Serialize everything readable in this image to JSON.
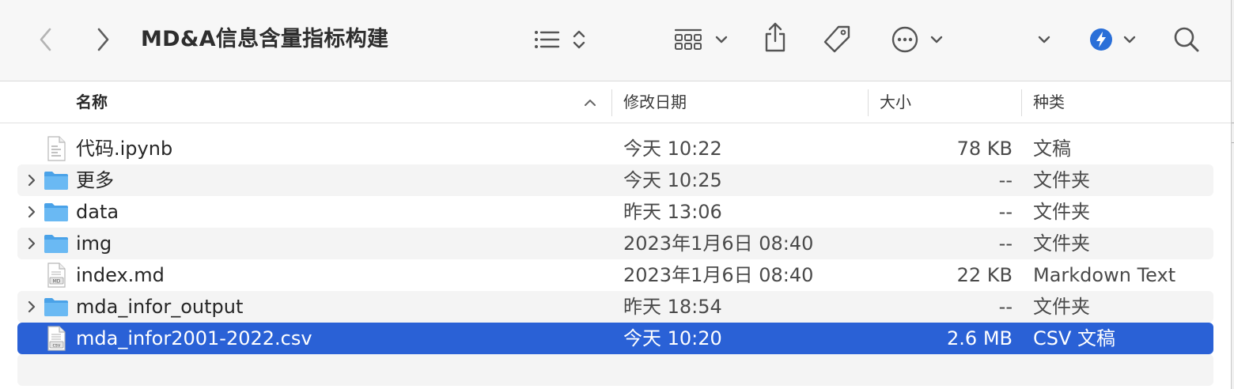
{
  "window": {
    "title": "MD&A信息含量指标构建"
  },
  "toolbar": {
    "back_icon": "chevron-left-icon",
    "forward_icon": "chevron-right-icon",
    "view_icon": "list-view-icon",
    "group_icon": "grid-group-icon",
    "share_icon": "share-icon",
    "tag_icon": "tag-icon",
    "more_icon": "ellipsis-circle-icon",
    "dropdown_icon": "chevron-down-icon",
    "siri_icon": "shortcuts-icon",
    "search_icon": "search-icon"
  },
  "columns": {
    "name": "名称",
    "date": "修改日期",
    "size": "大小",
    "kind": "种类"
  },
  "files": [
    {
      "name": "代码.ipynb",
      "date": "今天 10:22",
      "size": "78 KB",
      "kind": "文稿",
      "icon": "document-icon",
      "expandable": false,
      "selected": false
    },
    {
      "name": "更多",
      "date": "今天 10:25",
      "size": "--",
      "kind": "文件夹",
      "icon": "folder-icon",
      "expandable": true,
      "selected": false
    },
    {
      "name": "data",
      "date": "昨天 13:06",
      "size": "--",
      "kind": "文件夹",
      "icon": "folder-icon",
      "expandable": true,
      "selected": false
    },
    {
      "name": "img",
      "date": "2023年1月6日 08:40",
      "size": "--",
      "kind": "文件夹",
      "icon": "folder-icon",
      "expandable": true,
      "selected": false
    },
    {
      "name": "index.md",
      "date": "2023年1月6日 08:40",
      "size": "22 KB",
      "kind": "Markdown Text",
      "icon": "md-file-icon",
      "expandable": false,
      "selected": false
    },
    {
      "name": "mda_infor_output",
      "date": "昨天 18:54",
      "size": "--",
      "kind": "文件夹",
      "icon": "folder-icon",
      "expandable": true,
      "selected": false
    },
    {
      "name": "mda_infor2001-2022.csv",
      "date": "今天 10:20",
      "size": "2.6 MB",
      "kind": "CSV 文稿",
      "icon": "csv-file-icon",
      "expandable": false,
      "selected": true
    }
  ],
  "colors": {
    "selection": "#2a61d6",
    "folder": "#5aaef0",
    "accent": "#2a6fd8"
  }
}
